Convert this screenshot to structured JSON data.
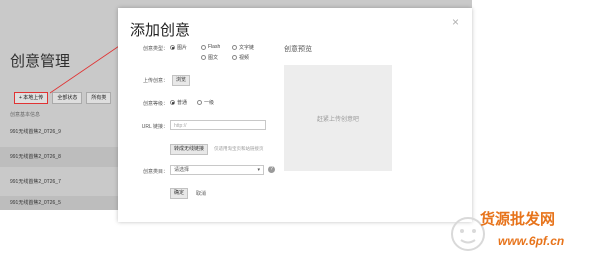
{
  "background": {
    "title": "创意管理",
    "toolbar": {
      "upload_label": "+ 本地上传",
      "status_label": "全部状态",
      "type_label": "所有类"
    },
    "column_header": "创意基本信息",
    "rows": [
      "991无线首焦2_0T26_9",
      "991无线首焦2_0T26_8",
      "991无线首焦2_0T26_7",
      "991无线首焦2_0T26_5"
    ]
  },
  "modal": {
    "title": "添加创意",
    "close_glyph": "×",
    "type_label": "创意类型：",
    "type_options": [
      "图片",
      "Flash",
      "文字链",
      "图文",
      "视频"
    ],
    "type_selected": "图片",
    "upload_label": "上传创意：",
    "browse_button": "浏览",
    "level_label": "创意等级：",
    "level_options": [
      "普通",
      "一级"
    ],
    "level_selected": "普通",
    "url_label": "URL 链接：",
    "url_placeholder": "http://",
    "convert_button": "转成无线链接",
    "convert_hint": "仅适用淘宝页和站链接页",
    "category_label": "创意类目：",
    "category_value": "请选择",
    "category_arrow": "▾",
    "help_glyph": "?",
    "confirm_button": "确定",
    "cancel_link": "取消",
    "preview_title": "创意预览",
    "preview_placeholder": "赶紧上传创意吧"
  },
  "watermark": {
    "text": "货源批发网",
    "url": "www.6pf.cn"
  },
  "colors": {
    "annotation_red": "#e03333",
    "watermark_orange": "#e7741c"
  }
}
